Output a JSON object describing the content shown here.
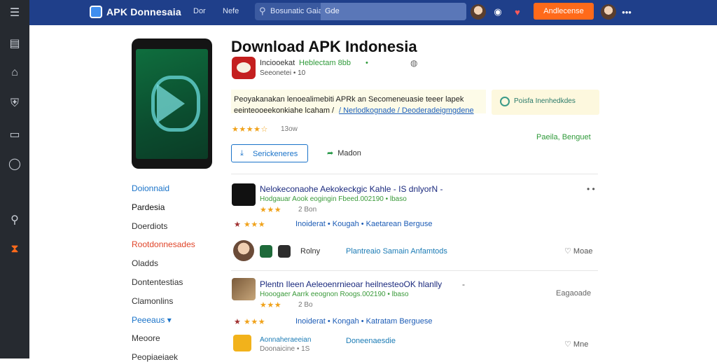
{
  "topbar": {
    "logo_text": "APK Donnesaia",
    "nav": [
      "Dor",
      "Nefe"
    ],
    "search_placeholder": "Bosunatic Gaiaa",
    "search_chip": "Gde",
    "cta_label": "Andlecense",
    "more_icon": "ellipsis-icon"
  },
  "rail": {
    "items": [
      "menu-icon",
      "box-icon",
      "home-icon",
      "shield-icon",
      "card-icon",
      "chat-icon",
      "search-icon",
      "hourglass-icon"
    ]
  },
  "app": {
    "title": "Download APK Indonesia",
    "dev_name": "Inciooekat",
    "dev_tag": "Heblectam 8bb",
    "dev_tag_suffix": "•",
    "dev_sub": "Seeonetei • 10",
    "desc_line1": "Peoyakanakan lenoealimebiti APRk an Secomeneuasie teeer lapek",
    "desc_line2a": "eeinteooeekonkiahe lcaham /",
    "desc_line2b": "/ Nerlodkognade / Deoderadeigmgdene",
    "notice": "Poisfa Inenhedkdes",
    "rating_stars": "★★★★☆",
    "rating_count": "13ow",
    "right_tag": "Paeila, Benguet",
    "install_label": "Serickeneres",
    "share_label": "Madon"
  },
  "categories": [
    {
      "label": "Doionnaid",
      "color": "#1a73c9"
    },
    {
      "label": "Pardesia",
      "color": "#111111"
    },
    {
      "label": "Doerdiots",
      "color": "#333333"
    },
    {
      "label": "Rootdonnesades",
      "color": "#e0452a"
    },
    {
      "label": "Oladds",
      "color": "#333333"
    },
    {
      "label": "Dontentestias",
      "color": "#333333"
    },
    {
      "label": "Clamonlins",
      "color": "#333333"
    },
    {
      "label": "Peeeaus ▾",
      "color": "#1a73c9"
    },
    {
      "label": "Meoore",
      "color": "#333333"
    },
    {
      "label": "Peopiaeiaek",
      "color": "#333333"
    }
  ],
  "rows": [
    {
      "title": "Nelokeconaohe Aekokeckgic Kahle - IS dnlyorN -",
      "sub": "Hodgauar Aook eogingin Fbeed.002190 • lbaso",
      "stars": "★★★",
      "meta": "2 Bon",
      "chips_prefix": "★",
      "chips_stars": "★★★",
      "chips": "Inoiderat  •  Kougah  •  Kaetarean  Berguse",
      "footer_label": "Rolny",
      "footer_link": "Plantreaio Samain  Anfamtods",
      "footer_more": "Moae",
      "menu": "• •"
    },
    {
      "title": "Plentn Ileen Aeleoenrnieoar heilnesteoOK hlanlly",
      "sub": "Hooogaer Aarrk eeognon Roogs.002190 • lbaso",
      "stars": "★★★",
      "meta": "2 Bo",
      "chips_prefix": "★",
      "chips_stars": "★★★",
      "chips": "Inoiderat  •  Kongah  •  Katratam  Berguese",
      "footer_label": "Aonnaheraeeian",
      "footer_sub": "Doonaicine  •  1S",
      "footer_link": "Doneenaesdie",
      "footer_more": "Mne",
      "side_tag": "Eagaoade",
      "menu": "-"
    }
  ]
}
